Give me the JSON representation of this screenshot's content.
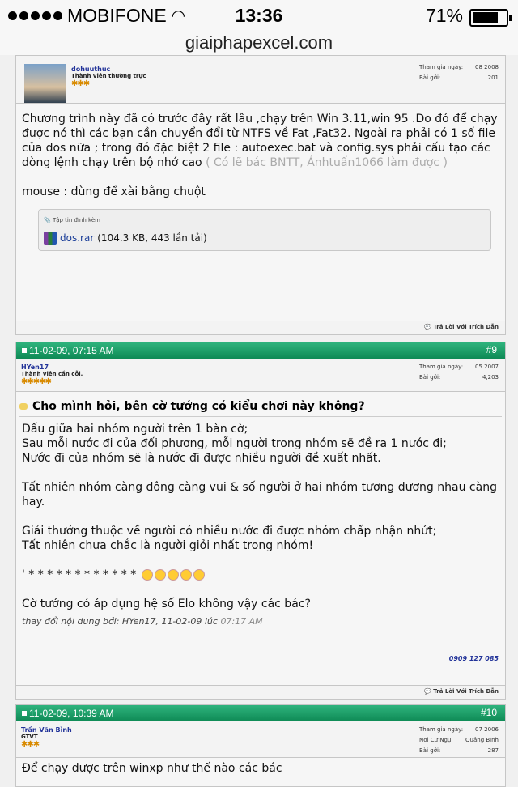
{
  "status": {
    "carrier": "MOBIFONE",
    "time": "13:36",
    "battery": "71%"
  },
  "url": "giaiphapexcel.com",
  "post1": {
    "user": "dohuuthuc",
    "title": "Thành viên thường trực",
    "join_label": "Tham gia ngày:",
    "join": "08 2008",
    "posts_label": "Bài gởi:",
    "posts": "201",
    "text": "Chương trình này đã có trước đây rất lâu ,chạy trên Win 3.11,win 95 .Do đó để chạy được nó thì các bạn cần chuyển đổi từ NTFS về Fat ,Fat32. Ngoài ra phải có 1 số file của dos nữa ; trong đó đặc biệt 2 file : autoexec.bat và config.sys phải cấu tạo các dòng lệnh chạy trên bộ nhớ cao",
    "faded": "( Có lẽ bác BNTT, Ảnhtuấn1066 làm được )",
    "mouse": "mouse : dùng để xài bằng chuột",
    "attach_title": "Tập tin đính kèm",
    "file": "dos.rar",
    "file_info": "(104.3 KB, 443 lần tải)",
    "reply": "Trả Lời Với Trích Dẫn"
  },
  "post2": {
    "date": "11-02-09,  07:15 AM",
    "num": "#9",
    "user": "HYen17",
    "title": "Thành viên cần cỗi.",
    "join_label": "Tham gia ngày:",
    "join": "05 2007",
    "posts_label": "Bài gởi:",
    "posts": "4,203",
    "heading": "Cho mình hỏi, bên cờ tướng có kiểu chơi này không?",
    "l1": "Đấu giữa hai nhóm người trên 1 bàn cờ;",
    "l2": "Sau mỗi nước đi của đối phương, mỗi người trong nhóm sẽ đề ra 1 nước đi;",
    "l3": "Nước đi của nhóm sẽ là nước đi được nhiều người đề xuất nhất.",
    "l4": "Tất nhiên nhóm càng đông càng vui & số người ở hai nhóm tương đương nhau càng hay.",
    "l5": "Giải thưởng thuộc về người có nhiều nước đi được nhóm chấp nhận nhứt;",
    "l6": "Tất nhiên chưa chắc là người giỏi nhất trong nhóm!",
    "l7": "' * * * * * * * * * * * *",
    "l8": "Cờ tướng có áp dụng hệ số Elo không vậy các bác?",
    "edited": "thay đổi nội dung bởi: HYen17, 11-02-09 lúc",
    "edited_time": "07:17 AM",
    "sig": "0909 127 085",
    "reply": "Trả Lời Với Trích Dẫn"
  },
  "post3": {
    "date": "11-02-09,  10:39 AM",
    "num": "#10",
    "user": "Trần Văn Bình",
    "title": "GTVT",
    "join_label": "Tham gia ngày:",
    "join": "07 2006",
    "loc_label": "Nơi Cư Ngụ:",
    "loc": "Quảng Bình",
    "posts_label": "Bài gởi:",
    "posts": "287",
    "text": "Để chạy được trên winxp như thế nào các bác"
  }
}
